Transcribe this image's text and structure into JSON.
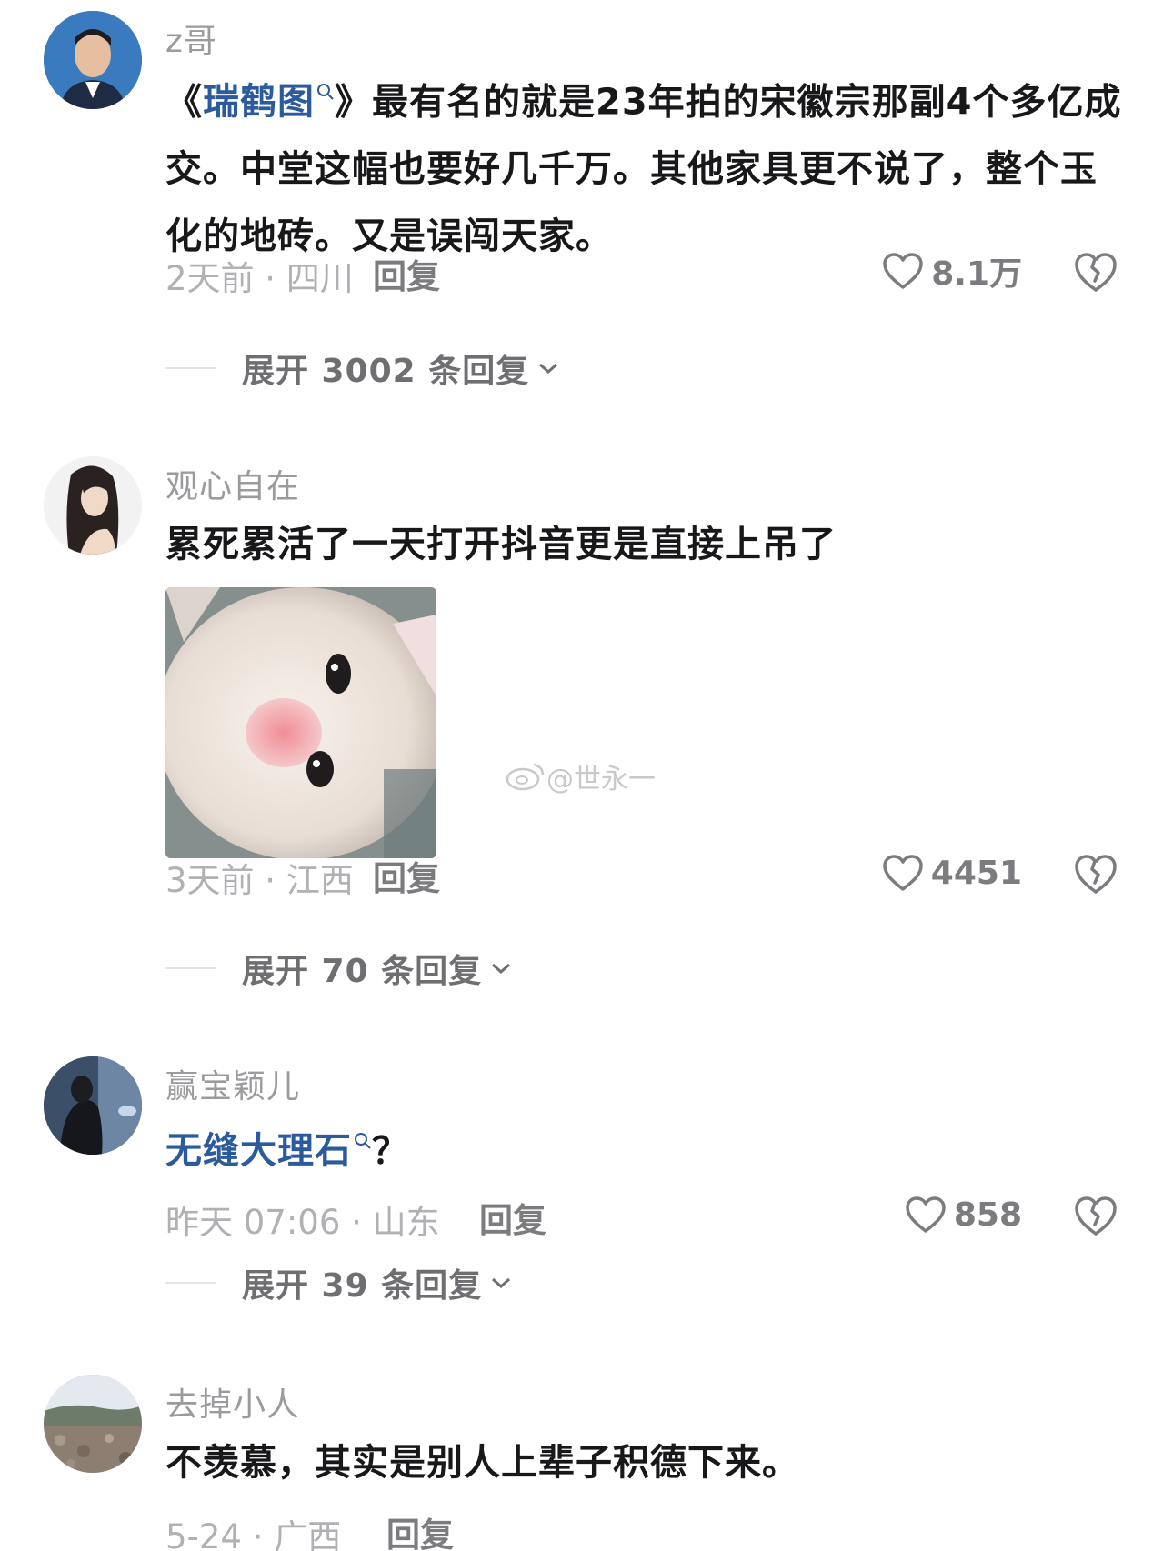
{
  "comments": [
    {
      "username": "z哥",
      "content_before": "《",
      "keyword": "瑞鹤图",
      "content_after": "》最有名的就是23年拍的宋徽宗那副4个多亿成交。中堂这幅也要好几千万。其他家具更不说了，整个玉化的地砖。又是误闯天家。",
      "meta": "2天前 · 四川",
      "reply_label": "回复",
      "likes": "8.1万",
      "expand_label": "展开 3002 条回复"
    },
    {
      "username": "观心自在",
      "content": "累死累活了一天打开抖音更是直接上吊了",
      "meta": "3天前 · 江西",
      "reply_label": "回复",
      "likes": "4451",
      "expand_label": "展开 70 条回复"
    },
    {
      "username": "赢宝颖儿",
      "keyword": "无缝大理石",
      "content_after": "？",
      "meta": "昨天 07:06 · 山东",
      "reply_label": "回复",
      "likes": "858",
      "expand_label": "展开 39 条回复"
    },
    {
      "username": "去掉小人",
      "content": "不羡慕，其实是别人上辈子积德下来。",
      "meta": "5-24 · 广西",
      "reply_label": "回复"
    }
  ],
  "watermark": "@世永一",
  "icons": {
    "search": "search-icon",
    "like": "heart-icon",
    "dislike": "broken-heart-icon",
    "expand": "chevron-down-icon"
  },
  "colors": {
    "keyword": "#2b5b9c",
    "meta": "#b0b0b5",
    "username": "#9a9a9f"
  }
}
